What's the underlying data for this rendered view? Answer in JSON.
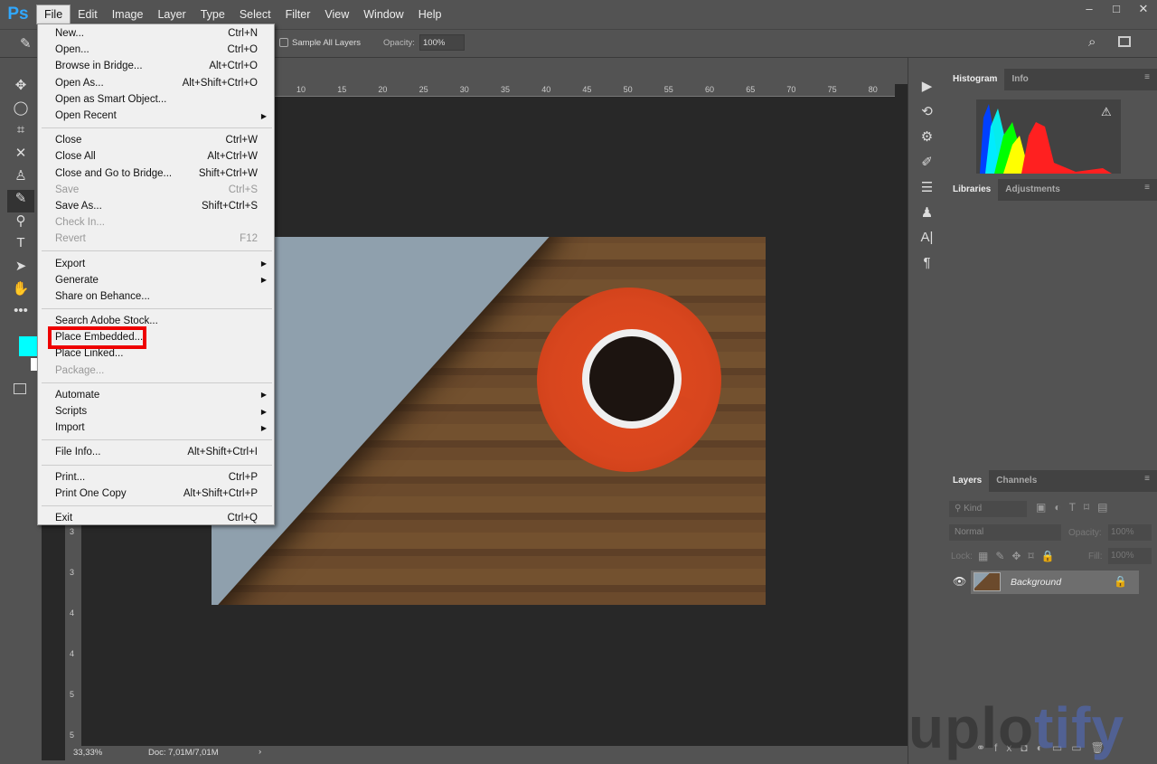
{
  "app": {
    "logo": "Ps"
  },
  "menubar": [
    "File",
    "Edit",
    "Image",
    "Layer",
    "Type",
    "Select",
    "Filter",
    "View",
    "Window",
    "Help"
  ],
  "window_controls": [
    "–",
    "□",
    "✕"
  ],
  "options": {
    "sample_all_layers": "Sample All Layers",
    "opacity_label": "Opacity:",
    "opacity_value": "100%"
  },
  "ruler_top": [
    "10",
    "15",
    "20",
    "25",
    "30",
    "35",
    "40",
    "45",
    "50",
    "55",
    "60",
    "65",
    "70",
    "75",
    "80"
  ],
  "ruler_left": [
    "3",
    "3",
    "4",
    "4",
    "5",
    "5"
  ],
  "status": {
    "zoom": "33,33%",
    "doc": "Doc: 7,01M/7,01M"
  },
  "file_menu": [
    [
      {
        "label": "New...",
        "sc": "Ctrl+N"
      },
      {
        "label": "Open...",
        "sc": "Ctrl+O"
      },
      {
        "label": "Browse in Bridge...",
        "sc": "Alt+Ctrl+O"
      },
      {
        "label": "Open As...",
        "sc": "Alt+Shift+Ctrl+O"
      },
      {
        "label": "Open as Smart Object...",
        "sc": ""
      },
      {
        "label": "Open Recent",
        "sc": "",
        "sub": true
      }
    ],
    [
      {
        "label": "Close",
        "sc": "Ctrl+W"
      },
      {
        "label": "Close All",
        "sc": "Alt+Ctrl+W"
      },
      {
        "label": "Close and Go to Bridge...",
        "sc": "Shift+Ctrl+W"
      },
      {
        "label": "Save",
        "sc": "Ctrl+S",
        "dis": true
      },
      {
        "label": "Save As...",
        "sc": "Shift+Ctrl+S"
      },
      {
        "label": "Check In...",
        "sc": "",
        "dis": true
      },
      {
        "label": "Revert",
        "sc": "F12",
        "dis": true
      }
    ],
    [
      {
        "label": "Export",
        "sc": "",
        "sub": true
      },
      {
        "label": "Generate",
        "sc": "",
        "sub": true
      },
      {
        "label": "Share on Behance...",
        "sc": ""
      }
    ],
    [
      {
        "label": "Search Adobe Stock...",
        "sc": ""
      },
      {
        "label": "Place Embedded...",
        "sc": ""
      },
      {
        "label": "Place Linked...",
        "sc": ""
      },
      {
        "label": "Package...",
        "sc": "",
        "dis": true
      }
    ],
    [
      {
        "label": "Automate",
        "sc": "",
        "sub": true
      },
      {
        "label": "Scripts",
        "sc": "",
        "sub": true
      },
      {
        "label": "Import",
        "sc": "",
        "sub": true
      }
    ],
    [
      {
        "label": "File Info...",
        "sc": "Alt+Shift+Ctrl+I"
      }
    ],
    [
      {
        "label": "Print...",
        "sc": "Ctrl+P"
      },
      {
        "label": "Print One Copy",
        "sc": "Alt+Shift+Ctrl+P"
      }
    ],
    [
      {
        "label": "Exit",
        "sc": "Ctrl+Q"
      }
    ]
  ],
  "panels": {
    "top_tabs": [
      "Histogram",
      "Info"
    ],
    "mid_tabs": [
      "Libraries",
      "Adjustments"
    ],
    "layers_tabs": [
      "Layers",
      "Channels"
    ],
    "kind_placeholder": "Kind",
    "blend_mode": "Normal",
    "opacity_label": "Opacity:",
    "opacity_value": "100%",
    "lock_label": "Lock:",
    "fill_label": "Fill:",
    "fill_value": "100%",
    "layer_name": "Background"
  },
  "watermark": {
    "pre": "uplo",
    "post": "tify"
  },
  "colors": {
    "foreground": "#00ffff",
    "highlight": "#e00000"
  }
}
